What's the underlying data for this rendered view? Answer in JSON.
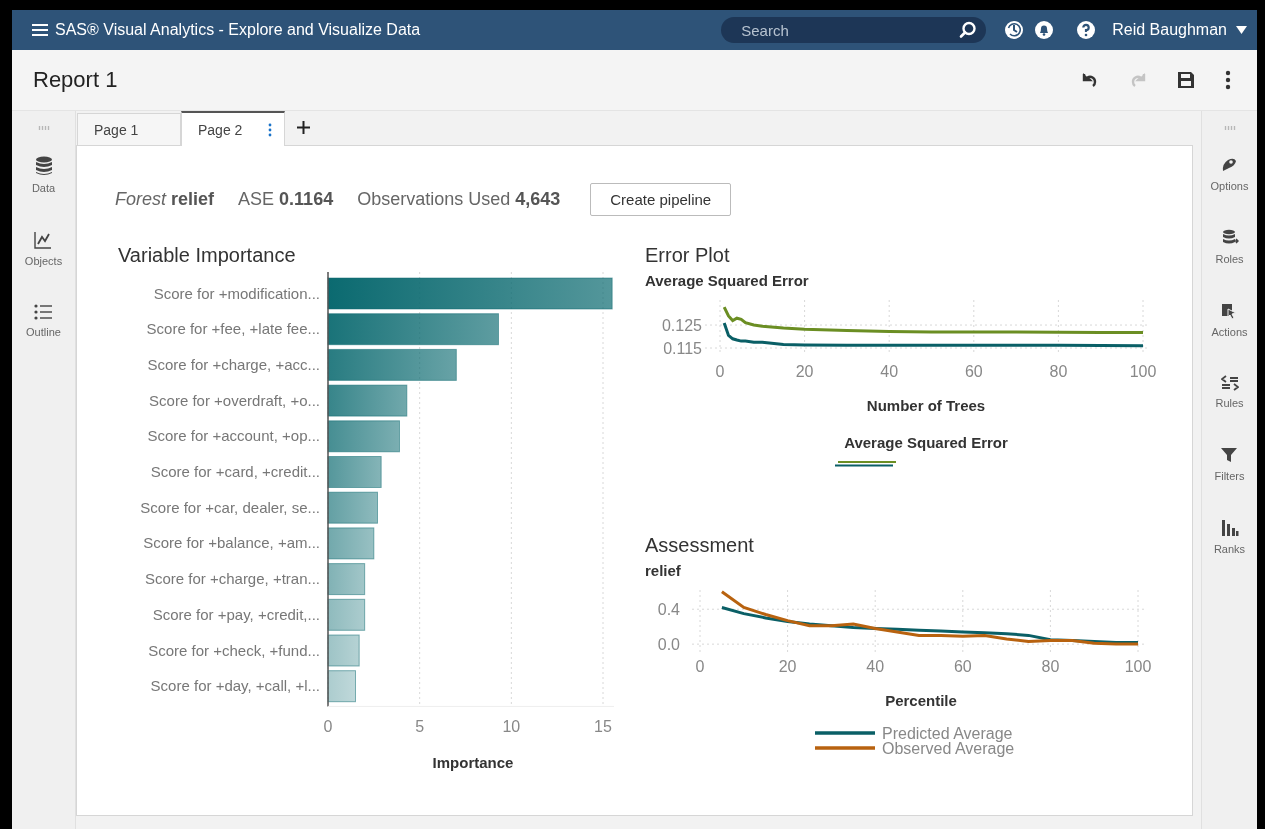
{
  "header": {
    "app_title": "SAS® Visual Analytics - Explore and Visualize Data",
    "search": {
      "placeholder": "Search"
    },
    "user": "Reid Baughman"
  },
  "report": {
    "title": "Report 1",
    "actions": [
      {
        "kind": "undo",
        "disabled": false
      },
      {
        "kind": "redo",
        "disabled": true
      },
      {
        "kind": "save",
        "disabled": false
      },
      {
        "kind": "more",
        "disabled": false
      }
    ]
  },
  "left_sidebar": {
    "items": [
      {
        "kind": "data",
        "label": "Data"
      },
      {
        "kind": "objects",
        "label": "Objects"
      },
      {
        "kind": "outline",
        "label": "Outline"
      }
    ]
  },
  "right_sidebar": {
    "items": [
      {
        "kind": "options",
        "label": "Options"
      },
      {
        "kind": "roles",
        "label": "Roles"
      },
      {
        "kind": "actions",
        "label": "Actions"
      },
      {
        "kind": "rules",
        "label": "Rules"
      },
      {
        "kind": "filters",
        "label": "Filters"
      },
      {
        "kind": "ranks",
        "label": "Ranks"
      }
    ]
  },
  "tabs": [
    {
      "label": "Page 1",
      "selected": false
    },
    {
      "label": "Page 2",
      "selected": true
    }
  ],
  "summary": {
    "model": "*Forest* **relief**",
    "ase": "ASE **0.1164**",
    "observations": "Observations Used **4,643**",
    "button": "Create pipeline"
  },
  "variable_importance": {
    "title": "Variable Importance",
    "chart_data": {
      "type": "bar",
      "orientation": "horizontal",
      "xlabel": "Importance",
      "categories": [
        "Score for +modification...",
        "Score for +fee, +late fee...",
        "Score for +charge, +acc...",
        "Score for +overdraft, +o...",
        "Score for +account, +op...",
        "Score for +card, +credit...",
        "Score for +car, dealer, se...",
        "Score for +balance, +am...",
        "Score for +charge, +tran...",
        "Score for +pay, +credit,...",
        "Score for +check, +fund...",
        "Score for +day, +call, +l..."
      ],
      "series": [
        {
          "color": "#0b6a70",
          "values": [
            15.5,
            9.3,
            7.0,
            4.3,
            3.9,
            2.9,
            2.7,
            2.5,
            2.0,
            2.0,
            1.7,
            1.5
          ]
        }
      ],
      "xlim": [
        0,
        15.6
      ],
      "xticks": [
        0,
        5,
        10,
        15
      ],
      "grid": true
    }
  },
  "error_plot": {
    "title": "Error Plot",
    "chart_data": {
      "type": "line",
      "title": "Average Squared Error",
      "xlabel": "Number of Trees",
      "x": [
        1,
        2,
        3,
        4,
        5,
        6,
        8,
        10,
        15,
        20,
        30,
        40,
        50,
        60,
        70,
        80,
        90,
        100
      ],
      "series": [
        {
          "color": "#6b8e23",
          "values": [
            0.1328,
            0.129,
            0.127,
            0.128,
            0.1275,
            0.126,
            0.125,
            0.1245,
            0.1237,
            0.1232,
            0.1226,
            0.1222,
            0.122,
            0.122,
            0.122,
            0.1219,
            0.1218,
            0.1218
          ]
        },
        {
          "color": "#0a5f66",
          "values": [
            0.1259,
            0.1205,
            0.119,
            0.1185,
            0.118,
            0.118,
            0.1175,
            0.1175,
            0.1165,
            0.1163,
            0.1162,
            0.1162,
            0.1162,
            0.1162,
            0.1162,
            0.1162,
            0.1161,
            0.116
          ]
        }
      ],
      "xlim": [
        0,
        100
      ],
      "ylim": [
        0.1124,
        0.1359
      ],
      "xticks": [
        0,
        20,
        40,
        60,
        80,
        100
      ],
      "yticks": [
        0.115,
        0.125
      ],
      "grid": true
    },
    "legend_title": "Average Squared Error"
  },
  "assessment": {
    "title": "Assessment",
    "chart_data": {
      "type": "line",
      "title": "relief",
      "xlabel": "Percentile",
      "x": [
        5,
        10,
        15,
        20,
        25,
        30,
        35,
        40,
        45,
        50,
        55,
        60,
        65,
        70,
        75,
        80,
        85,
        90,
        95,
        100
      ],
      "series": [
        {
          "name": "Predicted Average",
          "color": "#0a5f66",
          "values": [
            0.42,
            0.35,
            0.3,
            0.26,
            0.23,
            0.21,
            0.19,
            0.18,
            0.17,
            0.16,
            0.15,
            0.14,
            0.13,
            0.12,
            0.1,
            0.05,
            0.04,
            0.03,
            0.02,
            0.02
          ]
        },
        {
          "name": "Observed Average",
          "color": "#b8620f",
          "values": [
            0.6,
            0.42,
            0.34,
            0.27,
            0.21,
            0.21,
            0.23,
            0.18,
            0.14,
            0.1,
            0.1,
            0.09,
            0.1,
            0.06,
            0.03,
            0.04,
            0.04,
            0.01,
            0.0,
            0.0
          ]
        }
      ],
      "xlim": [
        0,
        100
      ],
      "ylim": [
        -0.09,
        0.62
      ],
      "xticks": [
        0,
        20,
        40,
        60,
        80,
        100
      ],
      "yticks": [
        {
          "value": 0,
          "label": "0.0"
        },
        0.4
      ],
      "grid": true,
      "legend": "bottom"
    }
  }
}
